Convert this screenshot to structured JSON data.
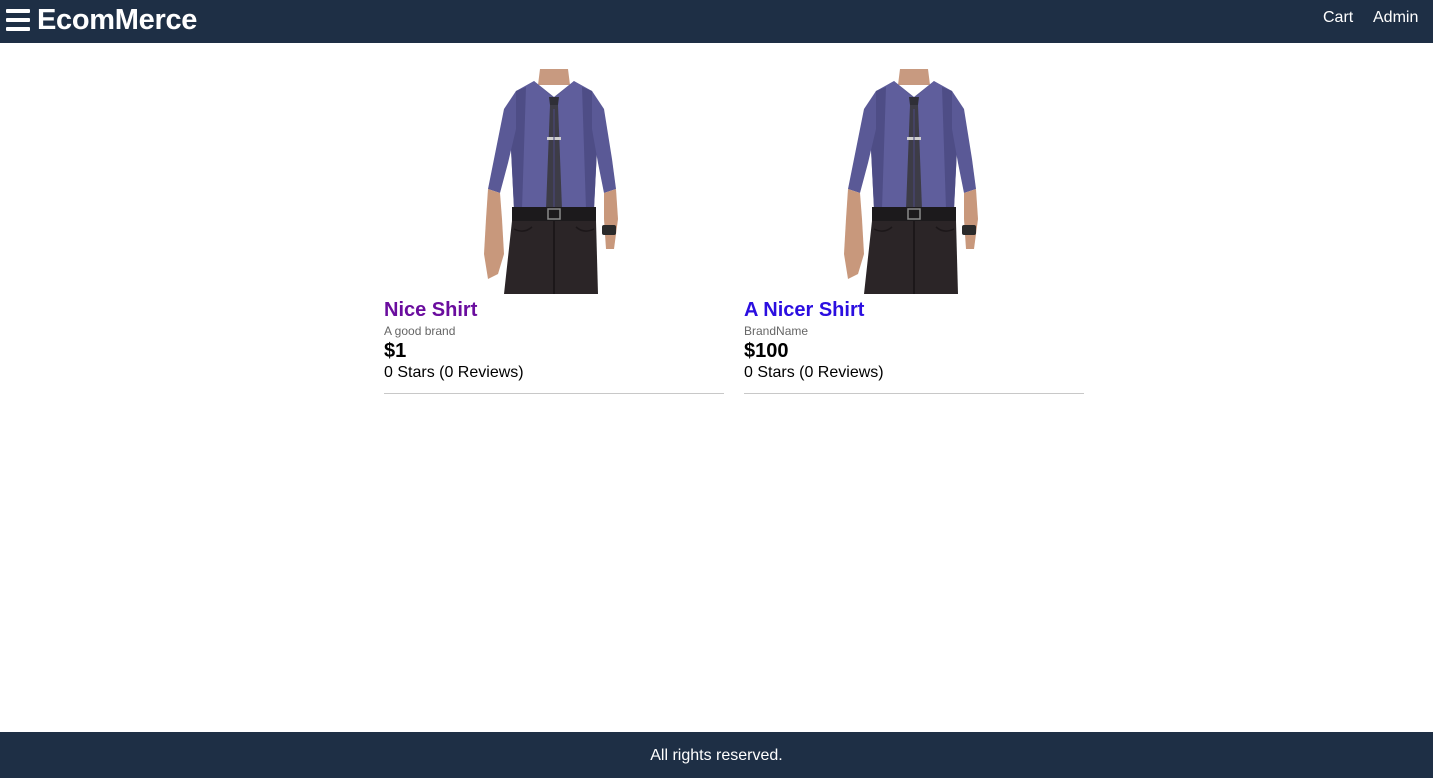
{
  "header": {
    "brand": "EcomMerce",
    "menu_icon": "hamburger-menu-icon",
    "nav": [
      {
        "label": "Cart"
      },
      {
        "label": "Admin"
      }
    ],
    "background_color": "#1e2f45"
  },
  "products": [
    {
      "name": "Nice Shirt",
      "brand": "A good brand",
      "price": "$1",
      "rating_text": "0 Stars (0 Reviews)",
      "image": "man-in-purple-shirt-and-tie",
      "name_color": "#6a0d9e"
    },
    {
      "name": "A Nicer Shirt",
      "brand": "BrandName",
      "price": "$100",
      "rating_text": "0 Stars (0 Reviews)",
      "image": "man-in-purple-shirt-and-tie",
      "name_color": "#2b0ee0"
    }
  ],
  "footer": {
    "text": "All rights reserved."
  }
}
